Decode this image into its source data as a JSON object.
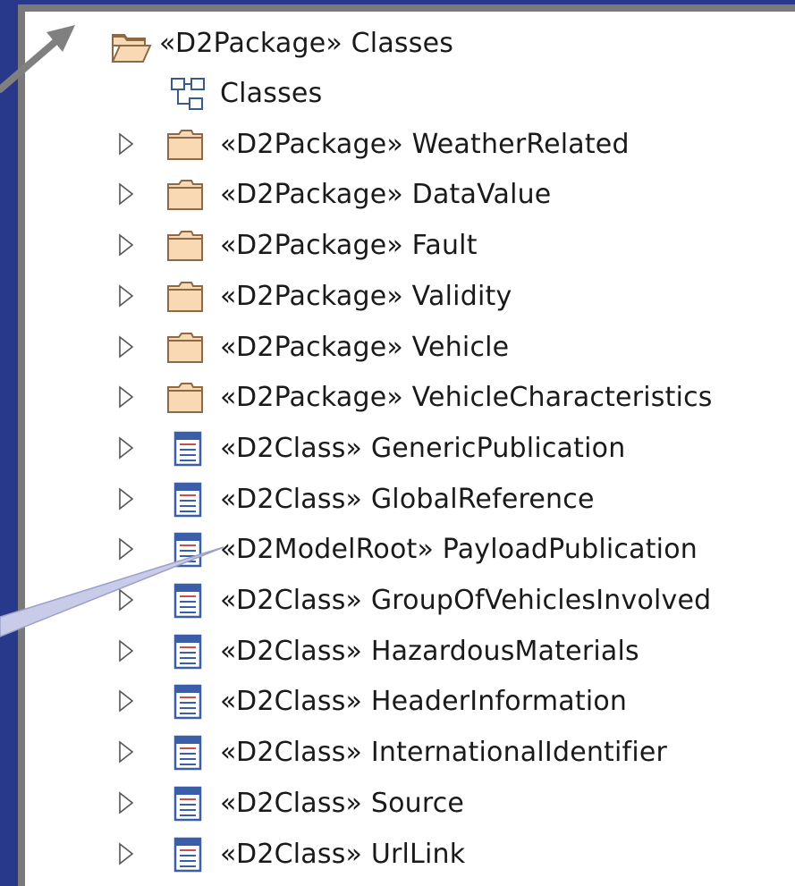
{
  "tree": {
    "root": {
      "label": "«D2Package» Classes",
      "icon": "open-folder-icon",
      "expanded": true
    },
    "items": [
      {
        "label": "Classes",
        "icon": "class-diagram-icon",
        "expandable": false
      },
      {
        "label": "«D2Package» WeatherRelated",
        "icon": "package-folder-icon",
        "expandable": true
      },
      {
        "label": "«D2Package» DataValue",
        "icon": "package-folder-icon",
        "expandable": true
      },
      {
        "label": "«D2Package» Fault",
        "icon": "package-folder-icon",
        "expandable": true
      },
      {
        "label": "«D2Package» Validity",
        "icon": "package-folder-icon",
        "expandable": true
      },
      {
        "label": "«D2Package» Vehicle",
        "icon": "package-folder-icon",
        "expandable": true
      },
      {
        "label": "«D2Package» VehicleCharacteristics",
        "icon": "package-folder-icon",
        "expandable": true
      },
      {
        "label": "«D2Class» GenericPublication",
        "icon": "class-icon",
        "expandable": true
      },
      {
        "label": "«D2Class» GlobalReference",
        "icon": "class-icon",
        "expandable": true
      },
      {
        "label": "«D2ModelRoot» PayloadPublication",
        "icon": "class-icon",
        "expandable": true
      },
      {
        "label": "«D2Class» GroupOfVehiclesInvolved",
        "icon": "class-icon",
        "expandable": true
      },
      {
        "label": "«D2Class» HazardousMaterials",
        "icon": "class-icon",
        "expandable": true
      },
      {
        "label": "«D2Class» HeaderInformation",
        "icon": "class-icon",
        "expandable": true
      },
      {
        "label": "«D2Class» InternationalIdentifier",
        "icon": "class-icon",
        "expandable": true
      },
      {
        "label": "«D2Class» Source",
        "icon": "class-icon",
        "expandable": true
      },
      {
        "label": "«D2Class» UrlLink",
        "icon": "class-icon",
        "expandable": true
      }
    ]
  },
  "colors": {
    "background": "#28388a",
    "panel_border": "#7a7a7a",
    "folder_fill": "#f8d9b4",
    "folder_stroke": "#8c6a48",
    "class_icon_blue": "#3a5fa8",
    "class_icon_red": "#c9504a",
    "callout_fill": "#c8cce8",
    "arrow_gray": "#808080"
  }
}
